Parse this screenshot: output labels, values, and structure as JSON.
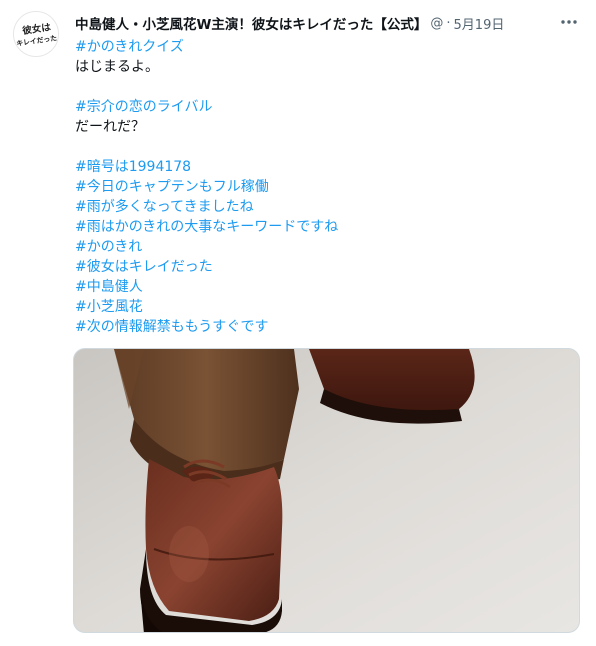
{
  "tweet": {
    "author": "中島健人・小芝風花W主演！彼女はキレイだった【公式】",
    "handle": "@",
    "separator": "·",
    "date": "5月19日",
    "lines": [
      {
        "text": "#かのきれクイズ",
        "type": "hashtag"
      },
      {
        "text": "はじまるよ。",
        "type": "plain"
      },
      {
        "text": "",
        "type": "gap"
      },
      {
        "text": "#宗介の恋のライバル",
        "type": "hashtag"
      },
      {
        "text": "だーれだ？",
        "type": "plain"
      },
      {
        "text": "",
        "type": "gap"
      },
      {
        "text": "#暗号は1994178",
        "type": "hashtag"
      },
      {
        "text": "#今日のキャプテンもフル稼働",
        "type": "hashtag"
      },
      {
        "text": "#雨が多くなってきましたね",
        "type": "hashtag"
      },
      {
        "text": "#雨はかのきれの大事なキーワードですね",
        "type": "hashtag"
      },
      {
        "text": "#かのきれ",
        "type": "hashtag"
      },
      {
        "text": "#彼女はキレイだった",
        "type": "hashtag"
      },
      {
        "text": "#中島健人",
        "type": "hashtag"
      },
      {
        "text": "#小芝風花",
        "type": "hashtag"
      },
      {
        "text": "#次の情報解禁ももうすぐです",
        "type": "hashtag"
      }
    ]
  },
  "avatar": {
    "logo_text_line1": "彼女は",
    "logo_text_line2": "キレイだった"
  },
  "icons": {
    "more": "more-options-icon",
    "avatar": "show-logo-avatar"
  },
  "colors": {
    "hashtag": "#1d9bf0",
    "text": "#0f1419",
    "muted": "#536471",
    "border": "#cfd9de"
  }
}
